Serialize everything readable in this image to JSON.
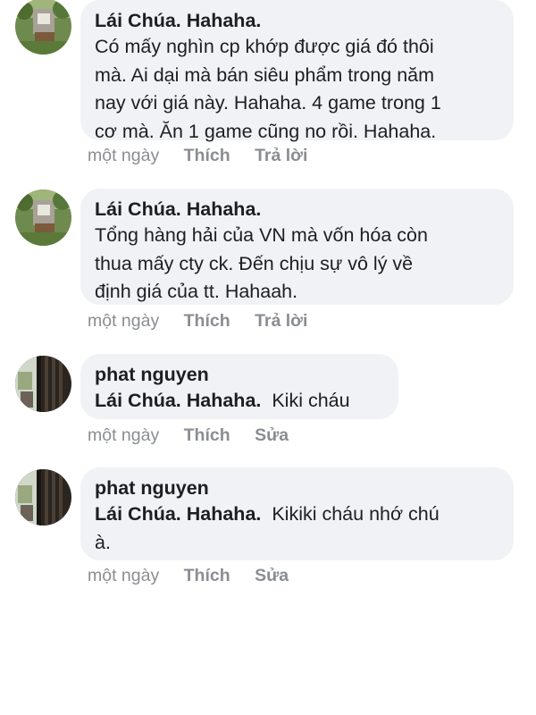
{
  "comments": [
    {
      "author": "Lái Chúa. Hahaha.",
      "mention": "",
      "text": "Có mấy nghìn cp khớp được giá đó thôi\nmà. Ai dại mà bán siêu phẩm trong năm\nnay với giá này. Hahaha. 4 game trong 1\ncơ mà. Ăn 1 game cũng no rồi. Hahaha.",
      "time": "một ngày",
      "like": "Thích",
      "reply": "Trả lời",
      "avatar_icon": "garden-photo-avatar-icon"
    },
    {
      "author": "Lái Chúa. Hahaha.",
      "mention": "",
      "text": "Tổng hàng hải của VN mà vốn hóa còn\nthua mấy cty ck. Đến chịu sự vô lý về\nđịnh giá của tt. Hahaah.",
      "time": "một ngày",
      "like": "Thích",
      "reply": "Trả lời",
      "avatar_icon": "garden-photo-avatar-icon"
    },
    {
      "author": "phat nguyen",
      "mention": "Lái Chúa. Hahaha.",
      "text": "Kiki cháu",
      "time": "một ngày",
      "like": "Thích",
      "reply": "Sửa",
      "avatar_icon": "window-photo-avatar-icon"
    },
    {
      "author": "phat nguyen",
      "mention": "Lái Chúa. Hahaha.",
      "text": "Kikiki cháu nhớ chú\nà.",
      "time": "một ngày",
      "like": "Thích",
      "reply": "Sửa",
      "avatar_icon": "window-photo-avatar-icon"
    }
  ],
  "colors": {
    "bubble": "#f0f2f5",
    "text": "#1c1e21",
    "meta": "#8a8d91"
  }
}
